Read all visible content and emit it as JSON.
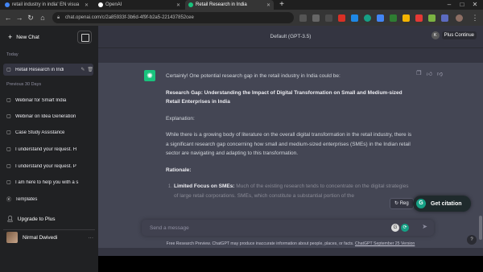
{
  "browser": {
    "tabs": [
      {
        "title": "retail industry in india' EN visua",
        "color": "#4285f4"
      },
      {
        "title": "OpenAI",
        "color": "#ffffff"
      },
      {
        "title": "Retail Research in India",
        "color": "#19c37d"
      }
    ],
    "new_tab": "+",
    "url": "chat.openai.com/c/2a85933f-3b6d-4f9f-b2a5-221437852cee",
    "window_controls": [
      "–",
      "□",
      "✕"
    ]
  },
  "sidebar": {
    "new_chat": "New Chat",
    "today_label": "Today",
    "today_items": [
      {
        "label": "Retail Research in Indi"
      }
    ],
    "previous_label": "Previous 30 Days",
    "previous_items": [
      {
        "label": "Webinar for Smart India"
      },
      {
        "label": "Webinar on Idea Generation"
      },
      {
        "label": "Case Study Assistance"
      },
      {
        "label": "I understand your request. H"
      },
      {
        "label": "I understand your request. P"
      },
      {
        "label": "I am here to help you with a s"
      },
      {
        "label": "Templates"
      }
    ],
    "upgrade": "Upgrade to Plus",
    "user_name": "Nirmal Dwivedi",
    "more": "···"
  },
  "main": {
    "model": "Default (GPT-3.5)",
    "k_badge": "K",
    "plus_continue": "Plus Continue",
    "message": {
      "intro": "Certainly! One potential research gap in the retail industry in India could be:",
      "gap_title": "Research Gap: Understanding the Impact of Digital Transformation on Small and Medium-sized Retail Enterprises in India",
      "explanation_label": "Explanation:",
      "explanation": "While there is a growing body of literature on the overall digital transformation in the retail industry, there is a significant research gap concerning how small and medium-sized enterprises (SMEs) in the Indian retail sector are navigating and adapting to this transformation.",
      "rationale_label": "Rationale:",
      "point1_title": "Limited Focus on SMEs:",
      "point1_text": "Much of the existing research tends to concentrate on the digital strategies of large retail corporations. SMEs, which constitute a substantial portion of the"
    },
    "regenerate": "Reg",
    "get_citation": "Get citation",
    "input_placeholder": "Send a message",
    "footer_text": "Free Research Preview. ChatGPT may produce inaccurate information about people, places, or facts.",
    "footer_link": "ChatGPT September 25 Version",
    "help": "?"
  }
}
